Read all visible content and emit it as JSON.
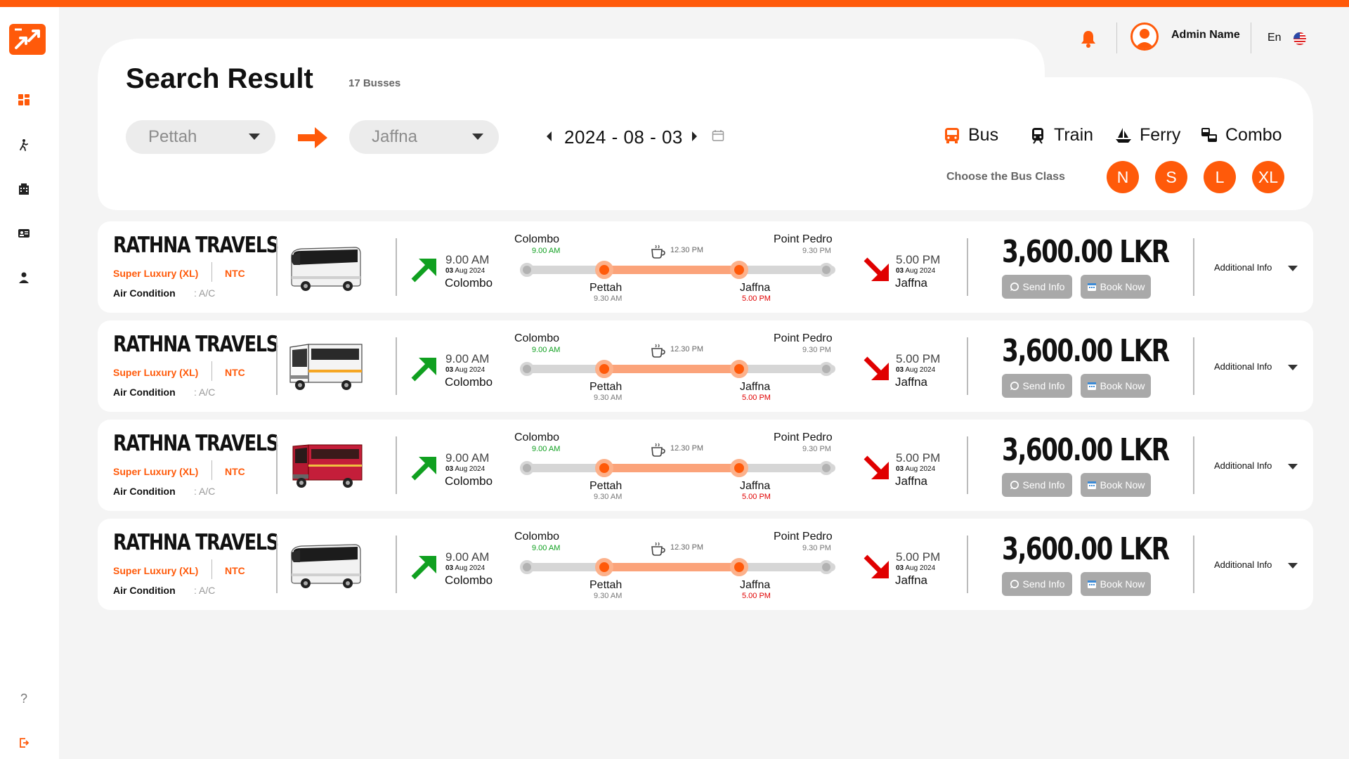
{
  "header": {
    "admin_name": "Admin Name",
    "language": "En",
    "title": "Search Result",
    "bus_count": "17 Busses"
  },
  "search": {
    "from": "Pettah",
    "to": "Jaffna",
    "date": "2024 - 08 - 03",
    "modes": [
      {
        "label": "Bus",
        "icon": "bus-icon"
      },
      {
        "label": "Train",
        "icon": "train-icon"
      },
      {
        "label": "Ferry",
        "icon": "ferry-icon"
      },
      {
        "label": "Combo",
        "icon": "combo-icon"
      }
    ],
    "choose_class_label": "Choose the Bus Class",
    "classes": [
      "N",
      "S",
      "L",
      "XL"
    ]
  },
  "sidebar": {
    "items": [
      "dashboard-icon",
      "traveler-icon",
      "building-icon",
      "id-card-icon",
      "user-icon",
      "help-icon",
      "logout-icon"
    ]
  },
  "results": [
    {
      "operator": "RATHNA TRAVELS",
      "bus_class": "Super Luxury (XL)",
      "type": "NTC",
      "ac_label": "Air Condition",
      "ac_value": ": A/C",
      "bus_image": "white-coach",
      "dep_time": "9.00 AM",
      "dep_date_day": "03",
      "dep_date_rest": " Aug 2024",
      "dep_city": "Colombo",
      "start_stop": "Colombo",
      "start_time": "9.00 AM",
      "board_stop": "Pettah",
      "board_time": "9.30 AM",
      "break_time": "12.30 PM",
      "drop_stop": "Jaffna",
      "drop_time": "5.00 PM",
      "end_stop": "Point Pedro",
      "end_time": "9.30 PM",
      "arr_time": "5.00 PM",
      "arr_date_day": "03",
      "arr_date_rest": " Aug 2024",
      "arr_city": "Jaffna",
      "price": "3,600.00 LKR",
      "send_label": "Send Info",
      "book_label": "Book Now",
      "info_label": "Additional Info"
    },
    {
      "operator": "RATHNA TRAVELS",
      "bus_class": "Super Luxury (XL)",
      "type": "NTC",
      "ac_label": "Air Condition",
      "ac_value": ": A/C",
      "bus_image": "white-bus",
      "dep_time": "9.00 AM",
      "dep_date_day": "03",
      "dep_date_rest": " Aug 2024",
      "dep_city": "Colombo",
      "start_stop": "Colombo",
      "start_time": "9.00 AM",
      "board_stop": "Pettah",
      "board_time": "9.30 AM",
      "break_time": "12.30 PM",
      "drop_stop": "Jaffna",
      "drop_time": "5.00 PM",
      "end_stop": "Point Pedro",
      "end_time": "9.30 PM",
      "arr_time": "5.00 PM",
      "arr_date_day": "03",
      "arr_date_rest": " Aug 2024",
      "arr_city": "Jaffna",
      "price": "3,600.00 LKR",
      "send_label": "Send Info",
      "book_label": "Book Now",
      "info_label": "Additional Info"
    },
    {
      "operator": "RATHNA TRAVELS",
      "bus_class": "Super Luxury (XL)",
      "type": "NTC",
      "ac_label": "Air Condition",
      "ac_value": ": A/C",
      "bus_image": "red-bus",
      "dep_time": "9.00 AM",
      "dep_date_day": "03",
      "dep_date_rest": " Aug 2024",
      "dep_city": "Colombo",
      "start_stop": "Colombo",
      "start_time": "9.00 AM",
      "board_stop": "Pettah",
      "board_time": "9.30 AM",
      "break_time": "12.30 PM",
      "drop_stop": "Jaffna",
      "drop_time": "5.00 PM",
      "end_stop": "Point Pedro",
      "end_time": "9.30 PM",
      "arr_time": "5.00 PM",
      "arr_date_day": "03",
      "arr_date_rest": " Aug 2024",
      "arr_city": "Jaffna",
      "price": "3,600.00 LKR",
      "send_label": "Send Info",
      "book_label": "Book Now",
      "info_label": "Additional Info"
    },
    {
      "operator": "RATHNA TRAVELS",
      "bus_class": "Super Luxury (XL)",
      "type": "NTC",
      "ac_label": "Air Condition",
      "ac_value": ": A/C",
      "bus_image": "white-coach",
      "dep_time": "9.00 AM",
      "dep_date_day": "03",
      "dep_date_rest": " Aug 2024",
      "dep_city": "Colombo",
      "start_stop": "Colombo",
      "start_time": "9.00 AM",
      "board_stop": "Pettah",
      "board_time": "9.30 AM",
      "break_time": "12.30 PM",
      "drop_stop": "Jaffna",
      "drop_time": "5.00 PM",
      "end_stop": "Point Pedro",
      "end_time": "9.30 PM",
      "arr_time": "5.00 PM",
      "arr_date_day": "03",
      "arr_date_rest": " Aug 2024",
      "arr_city": "Jaffna",
      "price": "3,600.00 LKR",
      "send_label": "Send Info",
      "book_label": "Book Now",
      "info_label": "Additional Info"
    }
  ],
  "colors": {
    "accent": "#ff5a0a",
    "departure": "#10a020",
    "arrival": "#e00000",
    "button": "#a9a9a9"
  }
}
